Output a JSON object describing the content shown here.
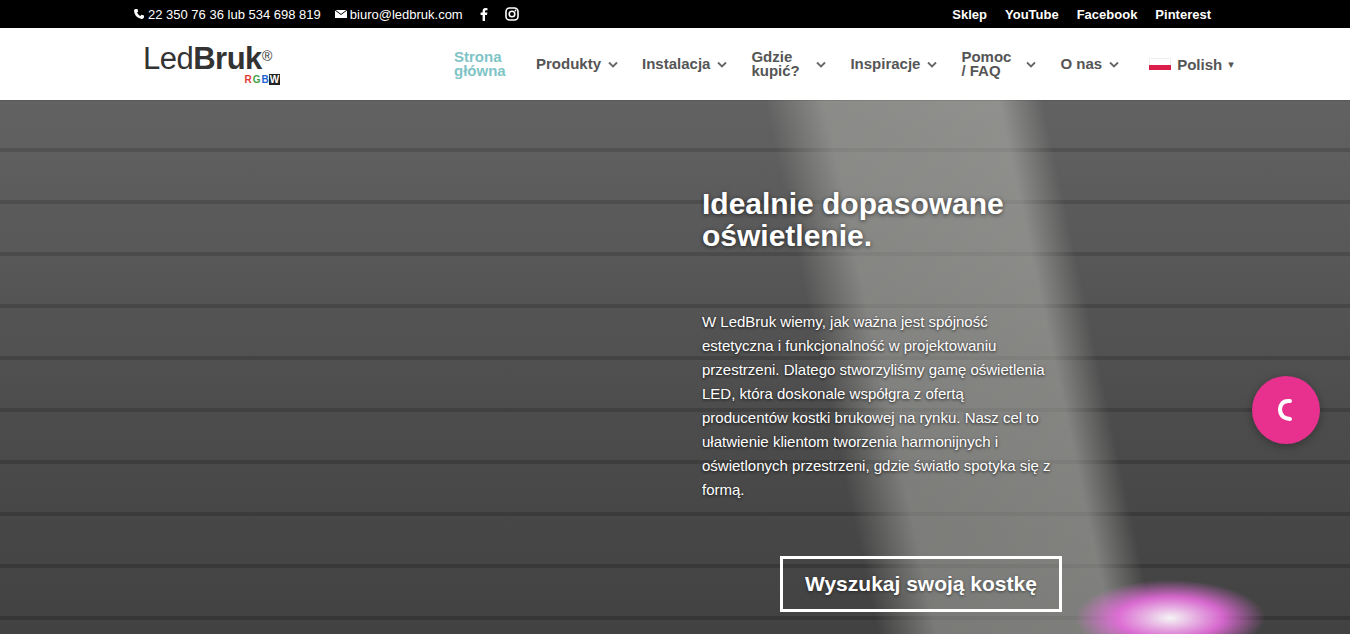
{
  "topbar": {
    "phone": "22 350 76 36 lub 534 698 819",
    "email": "biuro@ledbruk.com",
    "links": [
      "Sklep",
      "YouTube",
      "Facebook",
      "Pinterest"
    ]
  },
  "logo": {
    "light": "Led",
    "bold": "Bruk",
    "mark": "®",
    "sub": [
      {
        "text": "R",
        "color": "#e53935"
      },
      {
        "text": "G",
        "color": "#43a047"
      },
      {
        "text": "B",
        "color": "#1e63d6"
      },
      {
        "text": "W",
        "color": "#222222"
      }
    ]
  },
  "nav": {
    "items": [
      {
        "label": "Strona główna",
        "selected": true,
        "has_menu": false,
        "narrow": true
      },
      {
        "label": "Produkty",
        "selected": false,
        "has_menu": true,
        "narrow": false
      },
      {
        "label": "Instalacja",
        "selected": false,
        "has_menu": true,
        "narrow": false
      },
      {
        "label": "Gdzie kupić?",
        "selected": false,
        "has_menu": true,
        "narrow": true
      },
      {
        "label": "Inspiracje",
        "selected": false,
        "has_menu": true,
        "narrow": false
      },
      {
        "label": "Pomoc / FAQ",
        "selected": false,
        "has_menu": true,
        "narrow": true
      },
      {
        "label": "O nas",
        "selected": false,
        "has_menu": true,
        "narrow": false
      }
    ],
    "language": {
      "label": "Polish",
      "caret": "▾"
    }
  },
  "hero": {
    "heading": "Idealnie dopasowane oświetlenie.",
    "text": "W LedBruk wiemy, jak ważna jest spójność estetyczna i funkcjonalność w projektowaniu przestrzeni. Dlatego stworzyliśmy gamę oświetlenia LED, która doskonale współgra z ofertą producentów kostki brukowej na rynku. Nasz cel to ułatwienie klientom tworzenia harmonijnych i oświetlonych przestrzeni, gdzie światło spotyka się z formą.",
    "button": "Wyszukaj swoją kostkę"
  }
}
